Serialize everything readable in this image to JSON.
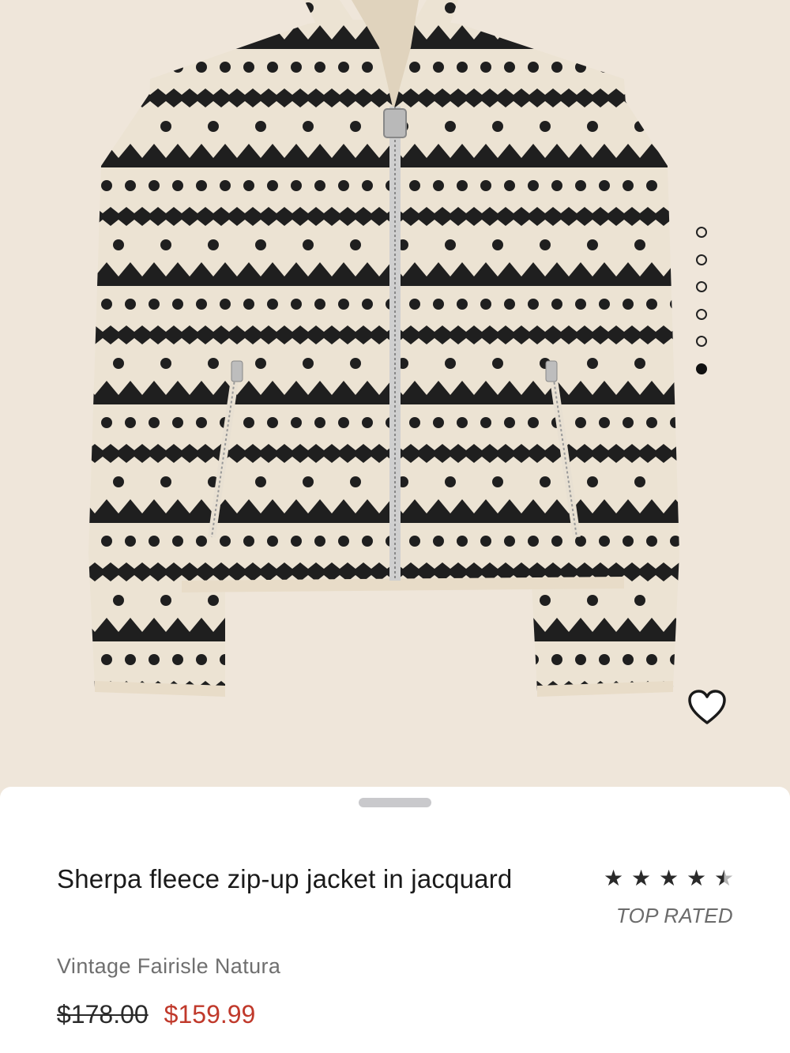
{
  "gallery": {
    "image_alt": "Sherpa fleece zip-up jacket in jacquard",
    "dot_count": 6,
    "active_dot_index": 5
  },
  "product": {
    "title": "Sherpa fleece zip-up jacket in jacquard",
    "rating_stars": 4.5,
    "rating_badge": "TOP RATED",
    "color_name": "Vintage Fairisle Natura",
    "original_price": "$178.00",
    "sale_price": "$159.99"
  },
  "colors": {
    "background": "#efe6da",
    "jacket_cream": "#ece3d3",
    "jacket_pattern": "#1f1f1f",
    "sale_red": "#c0392b",
    "text_primary": "#1a1a1a",
    "text_secondary": "#6f6f6f"
  },
  "icons": {
    "favorite": "heart-outline-icon",
    "rating": "star-icon"
  }
}
